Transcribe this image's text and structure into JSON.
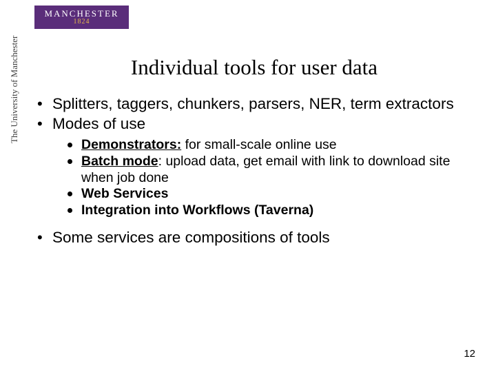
{
  "logo": {
    "wordmark": "MANCHESTER",
    "year": "1824",
    "vertical": "The University of Manchester"
  },
  "title": "Individual tools for user data",
  "bullets": {
    "b1": "Splitters, taggers, chunkers, parsers, NER, term extractors",
    "b2": "Modes of use",
    "sub": {
      "s1_bold": "Demonstrators:",
      "s1_rest": " for small-scale online use",
      "s2_bold": "Batch mode",
      "s2_rest": ": upload data, get email with link to download site when job done",
      "s3": "Web Services",
      "s4": "Integration into Workflows (Taverna)"
    },
    "b3": "Some services are compositions of tools"
  },
  "page_number": "12"
}
